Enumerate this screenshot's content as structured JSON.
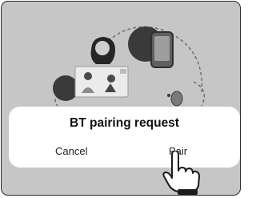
{
  "dialog": {
    "title": "BT pairing request",
    "cancel_label": "Cancel",
    "pair_label": "Pair"
  },
  "icons": {
    "pointer": "pointing-hand-icon",
    "phone": "smartphone-icon",
    "person": "person-icon",
    "video_call": "video-call-icon"
  },
  "colors": {
    "overlay": "#c6c6c6",
    "dialog_bg": "#ffffff",
    "text": "#111111"
  }
}
